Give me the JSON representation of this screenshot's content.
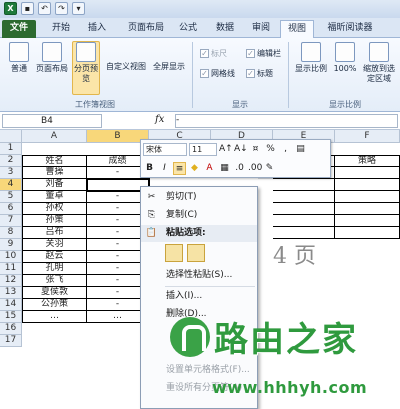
{
  "quick_access": {
    "undo": "↶",
    "redo": "↷",
    "more": "▾"
  },
  "tabs": [
    {
      "label": "文件",
      "kind": "file"
    },
    {
      "label": "开始"
    },
    {
      "label": "插入"
    },
    {
      "label": "页面布局"
    },
    {
      "label": "公式"
    },
    {
      "label": "数据"
    },
    {
      "label": "审阅"
    },
    {
      "label": "视图",
      "active": true
    },
    {
      "label": "福昕阅读器"
    }
  ],
  "ribbon": {
    "workbook_views": {
      "label": "工作簿视图",
      "buttons": [
        "普通",
        "页面布局",
        "分页预览",
        "自定义视图",
        "全屏显示"
      ]
    },
    "show": {
      "label": "显示",
      "checkboxes": [
        "标尺",
        "编辑栏",
        "网格线",
        "标题"
      ]
    },
    "zoom": {
      "label": "显示比例",
      "buttons": [
        "显示比例",
        "100%",
        "缩放到选定区域"
      ]
    }
  },
  "formula_bar": {
    "name_box": "B4",
    "fx": "fx",
    "dash": "-"
  },
  "columns": [
    "A",
    "B",
    "C",
    "D",
    "E",
    "F"
  ],
  "rows": [
    "1",
    "2",
    "3",
    "4",
    "5",
    "6",
    "7",
    "8",
    "9",
    "10",
    "11",
    "12",
    "13",
    "14",
    "15",
    "16",
    "17"
  ],
  "sheet": {
    "header_name": "姓名",
    "header_score": "成绩",
    "header_strategy": "策略",
    "names": [
      "曹操",
      "刘备",
      "董卓",
      "孙权",
      "孙策",
      "吕布",
      "关羽",
      "赵云",
      "孔明",
      "张飞",
      "夏侯敦",
      "公孙策",
      "…"
    ],
    "b_values": [
      "-",
      "",
      "-",
      "-",
      "-",
      "-",
      "-",
      "-",
      "-",
      "-",
      "-",
      "-",
      "…"
    ],
    "page_label": "4 页"
  },
  "mini_toolbar": {
    "font": "宋体",
    "size": "11",
    "grow": "A↑",
    "shrink": "A↓",
    "bold": "B",
    "italic": "I",
    "align": "≡",
    "percent": "%",
    "comma": ","
  },
  "context_menu": {
    "cut": "剪切(T)",
    "copy": "复制(C)",
    "paste_options": "粘贴选项:",
    "paste_special": "选择性粘贴(S)...",
    "insert": "插入(I)...",
    "delete": "删除(D)...",
    "format": "设置单元格格式(F)...",
    "reset_breaks": "重设所有分页符(A)"
  },
  "watermark": {
    "name": "路由之家",
    "url": "www.hhhyh.com"
  }
}
